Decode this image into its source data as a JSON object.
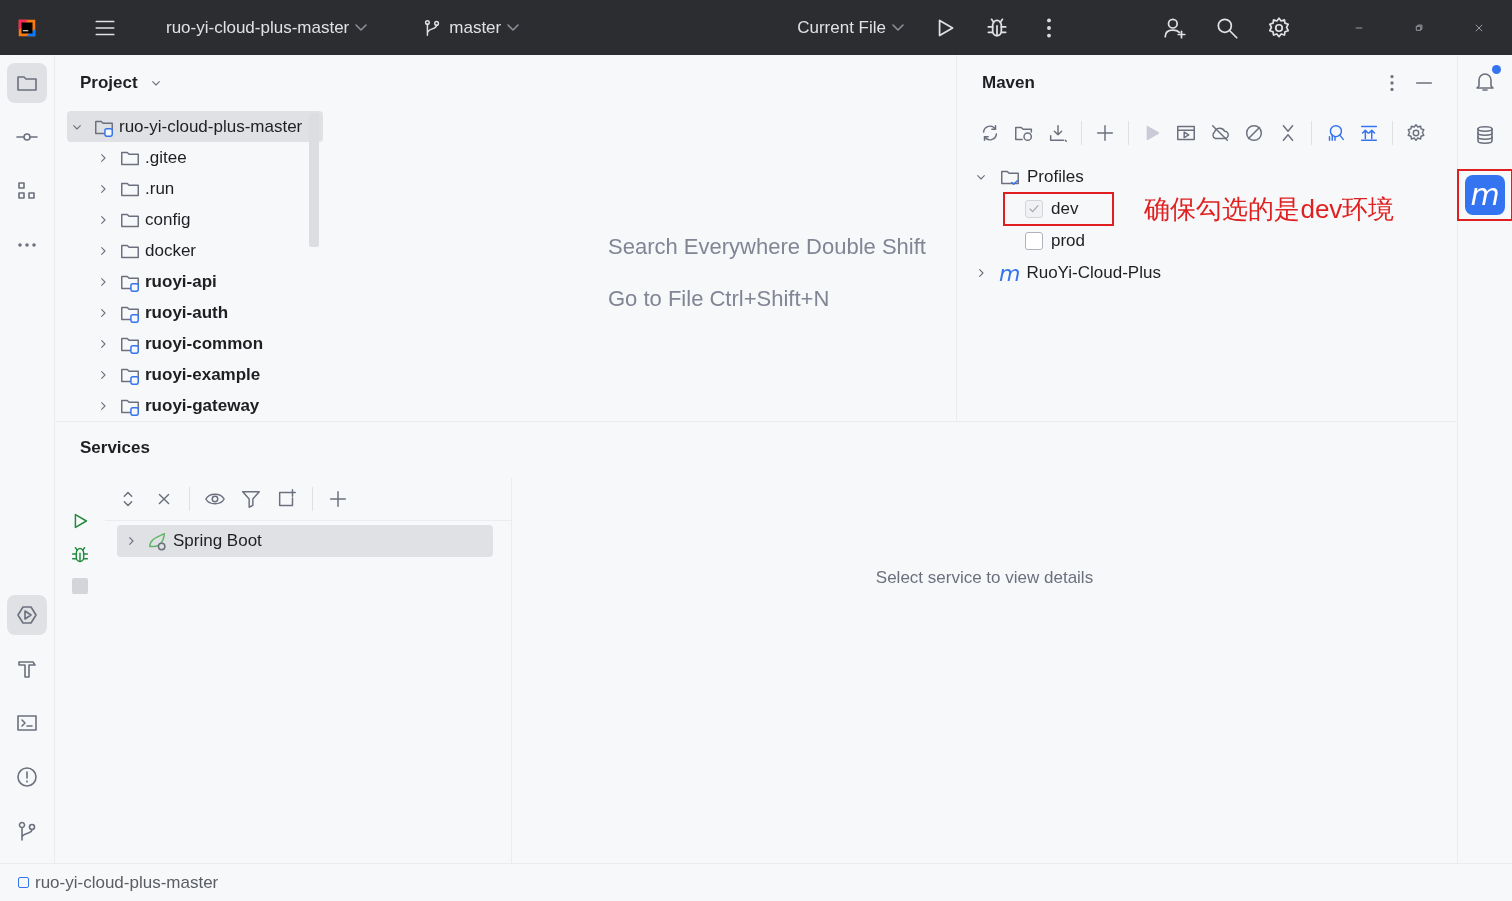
{
  "title_bar": {
    "project": "ruo-yi-cloud-plus-master",
    "branch": "master",
    "run_config": "Current File"
  },
  "left_toolbar_top": [
    {
      "selected": true
    },
    {
      "selected": false
    },
    {
      "selected": false
    },
    {
      "selected": false
    }
  ],
  "left_toolbar_bottom": [
    {
      "selected": true
    },
    {
      "selected": false
    },
    {
      "selected": false
    },
    {
      "selected": false
    },
    {
      "selected": false
    }
  ],
  "project_panel": {
    "title": "Project",
    "tree": [
      {
        "name": "ruo-yi-cloud-plus-master",
        "kind": "module",
        "expanded": true,
        "selected": true,
        "children": [
          {
            "name": ".gitee",
            "kind": "folder",
            "expanded": false,
            "selected": false
          },
          {
            "name": ".run",
            "kind": "folder",
            "expanded": false,
            "selected": false
          },
          {
            "name": "config",
            "kind": "folder",
            "expanded": false,
            "selected": false
          },
          {
            "name": "docker",
            "kind": "folder",
            "expanded": false,
            "selected": false
          },
          {
            "name": "ruoyi-api",
            "kind": "module",
            "expanded": false,
            "selected": false
          },
          {
            "name": "ruoyi-auth",
            "kind": "module",
            "expanded": false,
            "selected": false
          },
          {
            "name": "ruoyi-common",
            "kind": "module",
            "expanded": false,
            "selected": false
          },
          {
            "name": "ruoyi-example",
            "kind": "module",
            "expanded": false,
            "selected": false
          },
          {
            "name": "ruoyi-gateway",
            "kind": "module",
            "expanded": false,
            "selected": false
          }
        ]
      }
    ]
  },
  "editor_hints": [
    "Search Everywhere Double Shift",
    "Go to File Ctrl+Shift+N"
  ],
  "maven": {
    "title": "Maven",
    "tree": [
      {
        "name": "Profiles",
        "kind": "profiles",
        "expanded": true,
        "children": [
          {
            "name": "dev",
            "kind": "profile",
            "checked": true,
            "highlighted": true
          },
          {
            "name": "prod",
            "kind": "profile",
            "checked": false,
            "highlighted": false
          }
        ]
      },
      {
        "name": "RuoYi-Cloud-Plus",
        "kind": "project",
        "icon_text": "m",
        "expanded": false
      }
    ],
    "annotation": "确保勾选的是dev环境"
  },
  "right_toolbar": [
    {
      "selected": false,
      "badge": true,
      "highlighted": false
    },
    {
      "selected": false,
      "badge": false,
      "highlighted": false
    },
    {
      "selected": true,
      "badge": false,
      "highlighted": true,
      "icon_text": "m"
    }
  ],
  "services": {
    "title": "Services",
    "tree": [
      {
        "name": "Spring Boot",
        "expanded": false,
        "selected": true
      }
    ],
    "empty_text": "Select service to view details"
  },
  "status_bar": {
    "path": "ruo-yi-cloud-plus-master"
  }
}
